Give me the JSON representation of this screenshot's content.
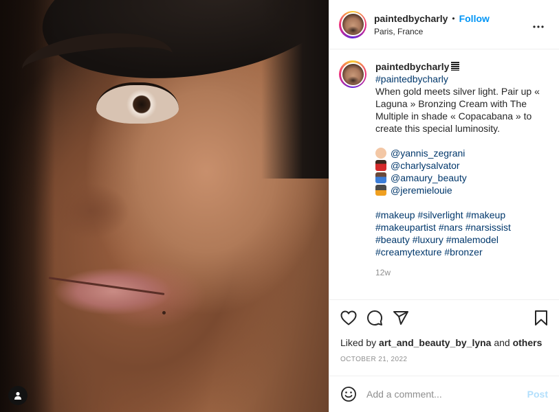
{
  "post": {
    "image_alt": "close-up portrait photo"
  },
  "header": {
    "username": "paintedbycharly",
    "separator": "•",
    "follow_label": "Follow",
    "location": "Paris, France"
  },
  "caption": {
    "username": "paintedbycharly",
    "hashtag_account": "#paintedbycharly",
    "text": "When gold meets silver light. Pair up « Laguna » Bronzing Cream with The Multiple in shade « Copacabana » to create this special luminosity.",
    "mentions": [
      {
        "emoji": "man-face",
        "handle": "@yannis_zegrani"
      },
      {
        "emoji": "person-red",
        "handle": "@charlysalvator"
      },
      {
        "emoji": "haircut",
        "handle": "@amaury_beauty"
      },
      {
        "emoji": "camera-flash",
        "handle": "@jeremielouie"
      }
    ],
    "hashtags": [
      "#makeup #silverlight #makeup",
      "#makeupartist #nars #narsissist",
      "#beauty #luxury #malemodel",
      "#creamytexture #bronzer"
    ],
    "time_ago": "12w"
  },
  "likes": {
    "prefix": "Liked by",
    "liker": "art_and_beauty_by_lyna",
    "conjunction": "and",
    "others": "others"
  },
  "date": "OCTOBER 21, 2022",
  "comment_box": {
    "placeholder": "Add a comment...",
    "post_label": "Post"
  },
  "colors": {
    "accent": "#0095f6",
    "link": "#00376b",
    "post_disabled": "#b2dffc",
    "muted": "#8e8e8e"
  }
}
